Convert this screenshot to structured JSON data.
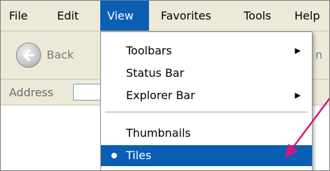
{
  "menubar": {
    "file": "File",
    "edit": "Edit",
    "view": "View",
    "favorites": "Favorites",
    "tools": "Tools",
    "help": "Help"
  },
  "toolbar": {
    "back_label": "Back",
    "right_fragment": "n"
  },
  "addressbar": {
    "label": "Address",
    "value": ""
  },
  "view_menu": {
    "toolbars": "Toolbars",
    "status_bar": "Status Bar",
    "explorer_bar": "Explorer Bar",
    "thumbnails": "Thumbnails",
    "tiles": "Tiles"
  },
  "colors": {
    "highlight": "#0a5fb4",
    "annotation_arrow": "#d4147f"
  }
}
